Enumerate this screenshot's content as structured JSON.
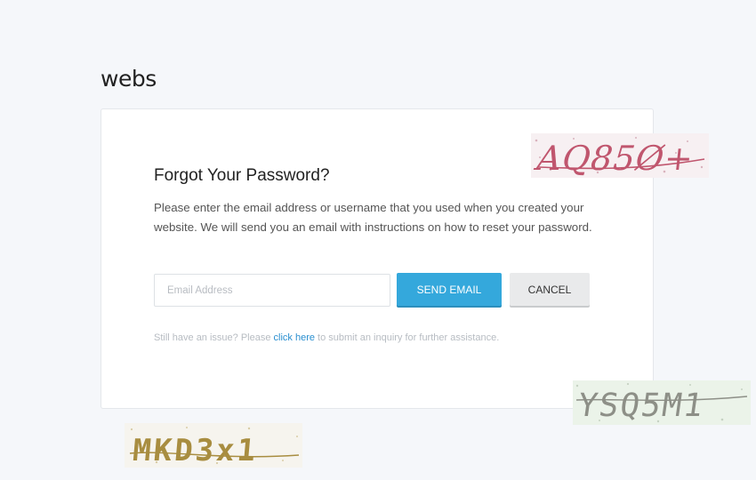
{
  "brand": {
    "logo_text": "webs"
  },
  "forgot": {
    "title": "Forgot Your Password?",
    "description": "Please enter the email address or username that you used when you created your website. We will send you an email with instructions on how to reset your password.",
    "email_placeholder": "Email Address",
    "send_label": "SEND EMAIL",
    "cancel_label": "CANCEL",
    "help_prefix": "Still have an issue? Please ",
    "help_link": "click here",
    "help_suffix": " to submit an inquiry for further assistance."
  },
  "captchas": [
    {
      "text": "AQ85Ø+",
      "color": "#c0566e",
      "background": "#f6eef0"
    },
    {
      "text": "YSQ5M1",
      "color": "#8d8f87",
      "background": "#eaf3e8"
    },
    {
      "text": "MKD3x1",
      "color": "#a88d40",
      "background": "#f5f3ec"
    }
  ],
  "colors": {
    "accent": "#34a8dc",
    "link": "#2a8fd0",
    "page_background": "#f5f7fa"
  }
}
